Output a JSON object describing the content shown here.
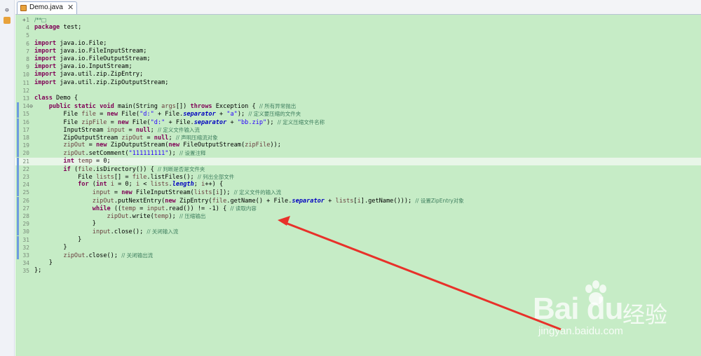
{
  "editor_tab": {
    "label": "Demo.java",
    "close": "✕"
  },
  "leftbar": {
    "icons": [
      "pin-icon",
      "package-explorer-icon"
    ]
  },
  "lines": [
    {
      "n": "1",
      "fold": "+",
      "segs": [
        {
          "t": "/**",
          "c": "cm"
        },
        {
          "t": "□",
          "c": "cm"
        }
      ]
    },
    {
      "n": "4",
      "segs": [
        {
          "t": "package",
          "c": "kw"
        },
        {
          "t": " test;"
        }
      ]
    },
    {
      "n": "5",
      "segs": []
    },
    {
      "n": "6",
      "segs": [
        {
          "t": "import",
          "c": "kw"
        },
        {
          "t": " java.io.File;"
        }
      ]
    },
    {
      "n": "7",
      "segs": [
        {
          "t": "import",
          "c": "kw"
        },
        {
          "t": " java.io.FileInputStream;"
        }
      ]
    },
    {
      "n": "8",
      "segs": [
        {
          "t": "import",
          "c": "kw"
        },
        {
          "t": " java.io.FileOutputStream;"
        }
      ]
    },
    {
      "n": "9",
      "segs": [
        {
          "t": "import",
          "c": "kw"
        },
        {
          "t": " java.io.InputStream;"
        }
      ]
    },
    {
      "n": "10",
      "segs": [
        {
          "t": "import",
          "c": "kw"
        },
        {
          "t": " java.util.zip.ZipEntry;"
        }
      ]
    },
    {
      "n": "11",
      "segs": [
        {
          "t": "import",
          "c": "kw"
        },
        {
          "t": " java.util.zip.ZipOutputStream;"
        }
      ]
    },
    {
      "n": "12",
      "segs": []
    },
    {
      "n": "13",
      "segs": [
        {
          "t": "class",
          "c": "kw"
        },
        {
          "t": " Demo {"
        }
      ]
    },
    {
      "n": "14",
      "fold": "⊖",
      "segs": [
        {
          "t": "    "
        },
        {
          "t": "public static void",
          "c": "kw"
        },
        {
          "t": " main(String "
        },
        {
          "t": "args",
          "c": "var"
        },
        {
          "t": "[]) "
        },
        {
          "t": "throws",
          "c": "kw"
        },
        {
          "t": " Exception { "
        },
        {
          "t": "// 所有异常抛出",
          "c": "cm"
        }
      ]
    },
    {
      "n": "15",
      "segs": [
        {
          "t": "        File "
        },
        {
          "t": "file",
          "c": "var"
        },
        {
          "t": " = "
        },
        {
          "t": "new",
          "c": "kw"
        },
        {
          "t": " File("
        },
        {
          "t": "\"d:\"",
          "c": "str"
        },
        {
          "t": " + File."
        },
        {
          "t": "separator",
          "c": "fld"
        },
        {
          "t": " + "
        },
        {
          "t": "\"a\"",
          "c": "str"
        },
        {
          "t": "); "
        },
        {
          "t": "// 定义要压缩的文件夹",
          "c": "cm"
        }
      ]
    },
    {
      "n": "16",
      "segs": [
        {
          "t": "        File "
        },
        {
          "t": "zipFile",
          "c": "var"
        },
        {
          "t": " = "
        },
        {
          "t": "new",
          "c": "kw"
        },
        {
          "t": " File("
        },
        {
          "t": "\"d:\"",
          "c": "str"
        },
        {
          "t": " + File."
        },
        {
          "t": "separator",
          "c": "fld"
        },
        {
          "t": " + "
        },
        {
          "t": "\"bb.zip\"",
          "c": "str"
        },
        {
          "t": "); "
        },
        {
          "t": "// 定义压缩文件名称",
          "c": "cm"
        }
      ]
    },
    {
      "n": "17",
      "segs": [
        {
          "t": "        InputStream "
        },
        {
          "t": "input",
          "c": "var"
        },
        {
          "t": " = "
        },
        {
          "t": "null",
          "c": "kw"
        },
        {
          "t": "; "
        },
        {
          "t": "// 定义文件输入流",
          "c": "cm"
        }
      ]
    },
    {
      "n": "18",
      "segs": [
        {
          "t": "        ZipOutputStream "
        },
        {
          "t": "zipOut",
          "c": "var"
        },
        {
          "t": " = "
        },
        {
          "t": "null",
          "c": "kw"
        },
        {
          "t": "; "
        },
        {
          "t": "// 声明压缩流对象",
          "c": "cm"
        }
      ]
    },
    {
      "n": "19",
      "segs": [
        {
          "t": "        "
        },
        {
          "t": "zipOut",
          "c": "var"
        },
        {
          "t": " = "
        },
        {
          "t": "new",
          "c": "kw"
        },
        {
          "t": " ZipOutputStream("
        },
        {
          "t": "new",
          "c": "kw"
        },
        {
          "t": " FileOutputStream("
        },
        {
          "t": "zipFile",
          "c": "var"
        },
        {
          "t": "));"
        }
      ]
    },
    {
      "n": "20",
      "segs": [
        {
          "t": "        "
        },
        {
          "t": "zipOut",
          "c": "var"
        },
        {
          "t": ".setComment("
        },
        {
          "t": "\"111111111\"",
          "c": "str"
        },
        {
          "t": "); "
        },
        {
          "t": "// 设置注释",
          "c": "cm"
        }
      ]
    },
    {
      "n": "21",
      "current": true,
      "segs": [
        {
          "t": "        "
        },
        {
          "t": "int",
          "c": "kw"
        },
        {
          "t": " "
        },
        {
          "t": "temp",
          "c": "var"
        },
        {
          "t": " = 0;"
        }
      ]
    },
    {
      "n": "22",
      "segs": [
        {
          "t": "        "
        },
        {
          "t": "if",
          "c": "kw"
        },
        {
          "t": " ("
        },
        {
          "t": "file",
          "c": "var"
        },
        {
          "t": ".isDirectory()) { "
        },
        {
          "t": "// 判断是否是文件夹",
          "c": "cm"
        }
      ]
    },
    {
      "n": "23",
      "segs": [
        {
          "t": "            File "
        },
        {
          "t": "lists",
          "c": "var"
        },
        {
          "t": "[] = "
        },
        {
          "t": "file",
          "c": "var"
        },
        {
          "t": ".listFiles(); "
        },
        {
          "t": "// 列出全部文件",
          "c": "cm"
        }
      ]
    },
    {
      "n": "24",
      "segs": [
        {
          "t": "            "
        },
        {
          "t": "for",
          "c": "kw"
        },
        {
          "t": " ("
        },
        {
          "t": "int",
          "c": "kw"
        },
        {
          "t": " "
        },
        {
          "t": "i",
          "c": "var"
        },
        {
          "t": " = 0; "
        },
        {
          "t": "i",
          "c": "var"
        },
        {
          "t": " < "
        },
        {
          "t": "lists",
          "c": "var"
        },
        {
          "t": "."
        },
        {
          "t": "length",
          "c": "fld"
        },
        {
          "t": "; "
        },
        {
          "t": "i",
          "c": "var"
        },
        {
          "t": "++) {"
        }
      ]
    },
    {
      "n": "25",
      "segs": [
        {
          "t": "                "
        },
        {
          "t": "input",
          "c": "var"
        },
        {
          "t": " = "
        },
        {
          "t": "new",
          "c": "kw"
        },
        {
          "t": " FileInputStream("
        },
        {
          "t": "lists",
          "c": "var"
        },
        {
          "t": "["
        },
        {
          "t": "i",
          "c": "var"
        },
        {
          "t": "]); "
        },
        {
          "t": "// 定义文件的输入流",
          "c": "cm"
        }
      ]
    },
    {
      "n": "26",
      "segs": [
        {
          "t": "                "
        },
        {
          "t": "zipOut",
          "c": "var"
        },
        {
          "t": ".putNextEntry("
        },
        {
          "t": "new",
          "c": "kw"
        },
        {
          "t": " ZipEntry("
        },
        {
          "t": "file",
          "c": "var"
        },
        {
          "t": ".getName() + File."
        },
        {
          "t": "separator",
          "c": "fld"
        },
        {
          "t": " + "
        },
        {
          "t": "lists",
          "c": "var"
        },
        {
          "t": "["
        },
        {
          "t": "i",
          "c": "var"
        },
        {
          "t": "].getName())); "
        },
        {
          "t": "// 设置ZipEntry对象",
          "c": "cm"
        }
      ]
    },
    {
      "n": "27",
      "segs": [
        {
          "t": "                "
        },
        {
          "t": "while",
          "c": "kw"
        },
        {
          "t": " (("
        },
        {
          "t": "temp",
          "c": "var"
        },
        {
          "t": " = "
        },
        {
          "t": "input",
          "c": "var"
        },
        {
          "t": ".read()) != -1) { "
        },
        {
          "t": "// 读取内容",
          "c": "cm"
        }
      ]
    },
    {
      "n": "28",
      "segs": [
        {
          "t": "                    "
        },
        {
          "t": "zipOut",
          "c": "var"
        },
        {
          "t": ".write("
        },
        {
          "t": "temp",
          "c": "var"
        },
        {
          "t": "); "
        },
        {
          "t": "// 压缩输出",
          "c": "cm"
        }
      ]
    },
    {
      "n": "29",
      "segs": [
        {
          "t": "                }"
        }
      ]
    },
    {
      "n": "30",
      "segs": [
        {
          "t": "                "
        },
        {
          "t": "input",
          "c": "var"
        },
        {
          "t": ".close(); "
        },
        {
          "t": "// 关闭输入流",
          "c": "cm"
        }
      ]
    },
    {
      "n": "31",
      "segs": [
        {
          "t": "            }"
        }
      ]
    },
    {
      "n": "32",
      "segs": [
        {
          "t": "        }"
        }
      ]
    },
    {
      "n": "33",
      "segs": [
        {
          "t": "        "
        },
        {
          "t": "zipOut",
          "c": "var"
        },
        {
          "t": ".close(); "
        },
        {
          "t": "// 关闭输出流",
          "c": "cm"
        }
      ]
    },
    {
      "n": "34",
      "segs": [
        {
          "t": "    }"
        }
      ]
    },
    {
      "n": "35",
      "segs": [
        {
          "t": "};"
        }
      ]
    }
  ],
  "marked_lines": [
    "14",
    "15",
    "16",
    "17",
    "18",
    "19",
    "20",
    "21",
    "22",
    "23",
    "24",
    "25",
    "26",
    "27",
    "28",
    "29",
    "30",
    "31",
    "32",
    "33"
  ],
  "watermark": {
    "logo": "Bai du",
    "cn": "经验",
    "sub": "jingyan.baidu.com"
  },
  "colors": {
    "editor_bg": "#c6ecc6",
    "arrow": "#e8312a",
    "marker": "#6f9be0"
  }
}
